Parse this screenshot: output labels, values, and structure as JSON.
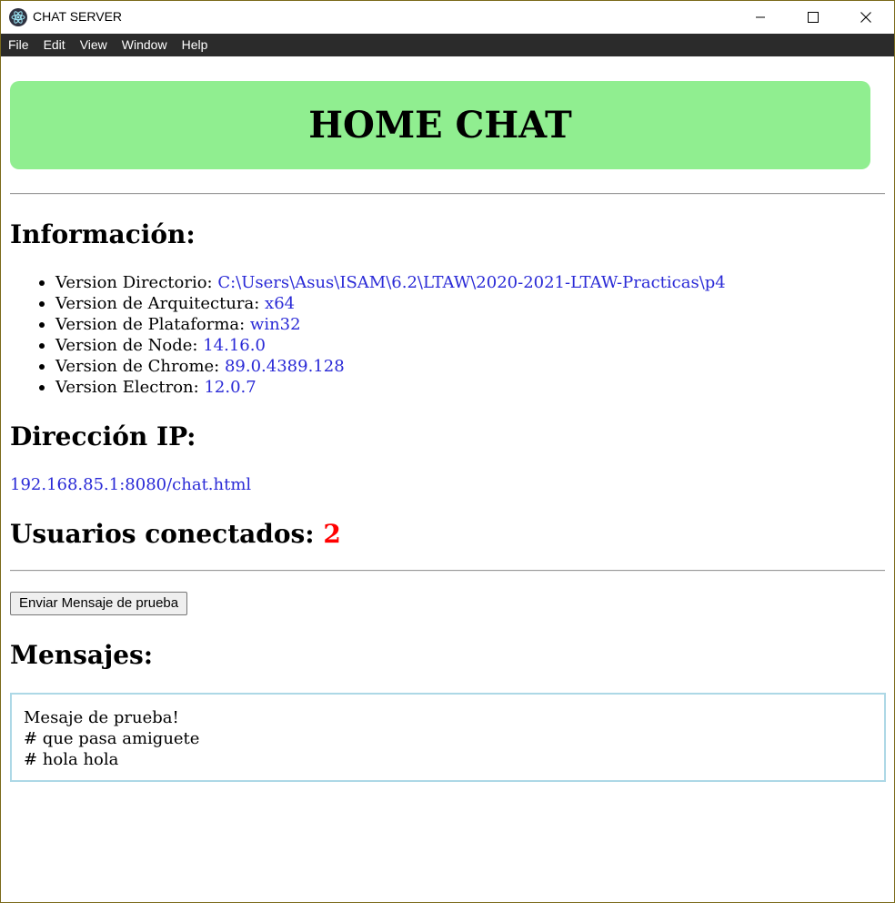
{
  "window": {
    "title": "CHAT SERVER",
    "icon": "electron-icon",
    "controls": [
      "minimize-icon",
      "maximize-icon",
      "close-icon"
    ]
  },
  "menu": {
    "items": [
      "File",
      "Edit",
      "View",
      "Window",
      "Help"
    ]
  },
  "banner": {
    "title": "HOME CHAT",
    "color": "#90ee90"
  },
  "info": {
    "heading": "Información:",
    "items": [
      {
        "label": "Version Directorio: ",
        "value": "C:\\Users\\Asus\\ISAM\\6.2\\LTAW\\2020-2021-LTAW-Practicas\\p4"
      },
      {
        "label": "Version de Arquitectura: ",
        "value": "x64"
      },
      {
        "label": "Version de Plataforma: ",
        "value": "win32"
      },
      {
        "label": "Version de Node: ",
        "value": "14.16.0"
      },
      {
        "label": "Version de Chrome: ",
        "value": "89.0.4389.128"
      },
      {
        "label": "Version Electron: ",
        "value": "12.0.7"
      }
    ]
  },
  "ip": {
    "heading": "Dirección IP:",
    "address": "192.168.85.1:8080/chat.html"
  },
  "users": {
    "heading": "Usuarios conectados: ",
    "count": "2"
  },
  "actions": {
    "test_button": "Enviar Mensaje de prueba"
  },
  "messages": {
    "heading": "Mensajes:",
    "lines": [
      "Mesaje de prueba!",
      "# que pasa amiguete",
      "# hola hola"
    ]
  },
  "colors": {
    "value_text": "#2929d6",
    "user_count": "#ff0000",
    "messages_border": "#add8e6",
    "menubar_bg": "#2b2b2b"
  }
}
